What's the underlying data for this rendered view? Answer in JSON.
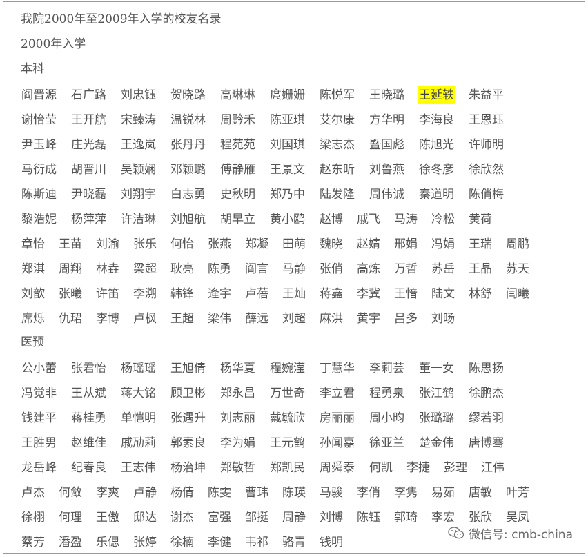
{
  "document": {
    "title": "我院2000年至2009年入学的校友名录",
    "year_heading": "2000年入学",
    "watermark": "微信号: cmb-china",
    "highlight_color": "#ffff00",
    "sections": [
      {
        "heading": "本科",
        "rows": [
          [
            "阎晋源",
            "石广路",
            "刘忠钰",
            "贺晓路",
            "高琳琳",
            "庹姗姗",
            "陈悦军",
            "王晓璐",
            "王延轶",
            "朱益平"
          ],
          [
            "谢怡莹",
            "王开航",
            "宋臻涛",
            "温锐林",
            "周黔禾",
            "陈亚琪",
            "艾尔康",
            "方华明",
            "李海良",
            "王恩珏"
          ],
          [
            "尹玉峰",
            "庄光磊",
            "王逸岚",
            "张丹丹",
            "程苑苑",
            "刘国琪",
            "梁志杰",
            "暨国彪",
            "陈旭光",
            "许师明"
          ],
          [
            "马衍成",
            "胡晋川",
            "吴颖娴",
            "邓颖璐",
            "傅静雁",
            "王景文",
            "赵东昕",
            "刘鲁燕",
            "徐冬彦",
            "徐欣然"
          ],
          [
            "陈斯迪",
            "尹晓磊",
            "刘翔宇",
            "白志勇",
            "史秋明",
            "郑乃中",
            "陆发隆",
            "周伟诚",
            "秦道明",
            "陈俏梅"
          ],
          [
            "黎浩妮",
            "杨萍萍",
            "许洁琳",
            "刘旭航",
            "胡早立",
            "黄小鸥",
            "赵博",
            "戚飞",
            "马涛",
            "冷松",
            "黄荷"
          ],
          [
            "章怡",
            "王苗",
            "刘渝",
            "张乐",
            "何怡",
            "张燕",
            "郑凝",
            "田萌",
            "魏晓",
            "赵婧",
            "邢娟",
            "冯娟",
            "王瑞",
            "周鹏"
          ],
          [
            "郑淇",
            "周翔",
            "林垚",
            "梁超",
            "耿亮",
            "陈勇",
            "阎言",
            "马静",
            "张俏",
            "高炼",
            "万哲",
            "苏岳",
            "王晶",
            "苏天"
          ],
          [
            "刘歆",
            "张曦",
            "许笛",
            "李溯",
            "韩锋",
            "逄宇",
            "卢蓓",
            "王灿",
            "蒋鑫",
            "李冀",
            "王愔",
            "陆文",
            "林舒",
            "闫曦"
          ],
          [
            "席烁",
            "仇珺",
            "李博",
            "卢枫",
            "王超",
            "梁伟",
            "薛远",
            "刘超",
            "麻洪",
            "黄宇",
            "吕多",
            "刘旸"
          ]
        ]
      },
      {
        "heading": "医预",
        "rows": [
          [
            "公小蕾",
            "张君怡",
            "杨瑶瑶",
            "王旭倩",
            "杨华夏",
            "程婉滢",
            "丁慧华",
            "李莉芸",
            "董一女",
            "陈思扬"
          ],
          [
            "冯觉非",
            "王从斌",
            "蒋大铭",
            "顾卫彬",
            "郑永昌",
            "万世奇",
            "李立君",
            "程勇泉",
            "张江鹤",
            "徐鹏杰"
          ],
          [
            "钱建平",
            "蒋桂勇",
            "单恺明",
            "张遇升",
            "刘志丽",
            "戴毓欣",
            "房丽丽",
            "周小昀",
            "张璐璐",
            "缪若羽"
          ],
          [
            "王胜男",
            "赵维佳",
            "戚劢莉",
            "郭素良",
            "李为娟",
            "王元鹤",
            "孙闻嘉",
            "徐亚兰",
            "楚金伟",
            "唐博骞"
          ],
          [
            "龙岳峰",
            "纪春良",
            "王志伟",
            "杨治坤",
            "郑敏哲",
            "郑凯民",
            "周舜泰",
            "何凯",
            "李捷",
            "彭理",
            "江伟"
          ],
          [
            "卢杰",
            "何敛",
            "李爽",
            "卢静",
            "杨倩",
            "陈雯",
            "曹玮",
            "陈瑛",
            "马骏",
            "李俏",
            "李隽",
            "易茹",
            "唐敏",
            "叶芳"
          ],
          [
            "徐栩",
            "何理",
            "王傲",
            "邸达",
            "谢杰",
            "富强",
            "邹挺",
            "周静",
            "刘博",
            "陈钰",
            "郭琦",
            "李宏",
            "张欣",
            "吴凤"
          ],
          [
            "蔡芳",
            "潘盈",
            "乐偲",
            "张婷",
            "徐楠",
            "李健",
            "韦祁",
            "骆青",
            "钱明"
          ]
        ]
      }
    ]
  }
}
